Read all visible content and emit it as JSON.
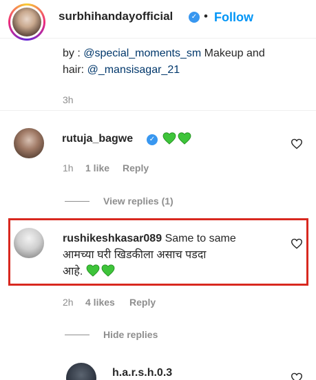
{
  "header": {
    "username": "surbhihandayofficial",
    "separator": "•",
    "follow_label": "Follow",
    "verified_icon": "verified-badge-icon",
    "accent": "#0095f6"
  },
  "caption": {
    "line1_prefix": "by : ",
    "line1_link": "@special_moments_sm",
    "line1_suffix": " Makeup and",
    "line2_prefix": "hair: ",
    "line2_link": "@_mansisagar_21",
    "time": "3h"
  },
  "comments": [
    {
      "username": "rutuja_bagwe",
      "verified": true,
      "emoji": "green-heart x2",
      "time": "1h",
      "likes": "1 like",
      "reply_label": "Reply",
      "view_replies": "View replies (1)"
    },
    {
      "username": "rushikeshkasar089",
      "text_line1": "Same to same",
      "text_line2": "आमच्या घरी खिडकीला असाच पडदा",
      "text_line3": "आहे.",
      "emoji": "green-heart x2",
      "time": "2h",
      "likes": "4 likes",
      "reply_label": "Reply",
      "hide_replies": "Hide replies",
      "highlight_color": "#d8281f"
    },
    {
      "username": "h.a.r.s.h.0.3"
    }
  ]
}
